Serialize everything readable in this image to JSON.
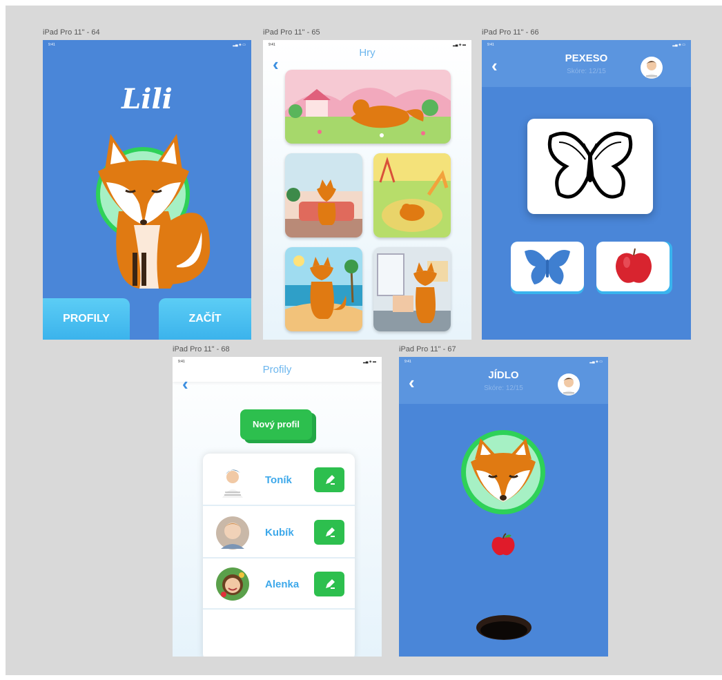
{
  "frames": {
    "home": {
      "label": "iPad Pro 11\" - 64",
      "status_time": "9:41",
      "status_icons": "▂▄ ◈ ▭",
      "logo_text": "Lili",
      "buttons": {
        "profiles": "PROFILY",
        "start": "ZAČÍT"
      }
    },
    "games": {
      "label": "iPad Pro 11\" - 65",
      "status_time": "9:41",
      "status_icons": "▂▄ ◈ ▬",
      "title": "Hry",
      "back": "‹"
    },
    "pexeso": {
      "label": "iPad Pro 11\" - 66",
      "status_time": "9:41",
      "status_icons": "▂▄ ◈ ▭",
      "title": "PEXESO",
      "score": "Skóre: 12/15",
      "back": "‹"
    },
    "profiles": {
      "label": "iPad Pro 11\" - 68",
      "status_time": "9:41",
      "status_icons": "▂▄ ◈ ▬",
      "title": "Profily",
      "back": "‹",
      "new_profile": "Nový profil",
      "items": [
        {
          "name": "Toník"
        },
        {
          "name": "Kubík"
        },
        {
          "name": "Alenka"
        }
      ]
    },
    "food": {
      "label": "iPad Pro 11\" - 67",
      "status_time": "9:41",
      "status_icons": "▂▄ ◈ ▭",
      "title": "JÍDLO",
      "score": "Skóre: 12/15",
      "back": "‹"
    }
  },
  "colors": {
    "blue_bg": "#4a86d8",
    "header_blue": "#5b95df",
    "light_blue_btn": "#4cc3f0",
    "green": "#2dbf4e",
    "fox_orange": "#e07a12",
    "title_light_blue": "#6cb6ee"
  },
  "icons": [
    "back-chevron-icon",
    "edit-pencil-icon",
    "avatar-icon",
    "fox-illustration",
    "butterfly-icon",
    "apple-icon",
    "hole-icon"
  ]
}
